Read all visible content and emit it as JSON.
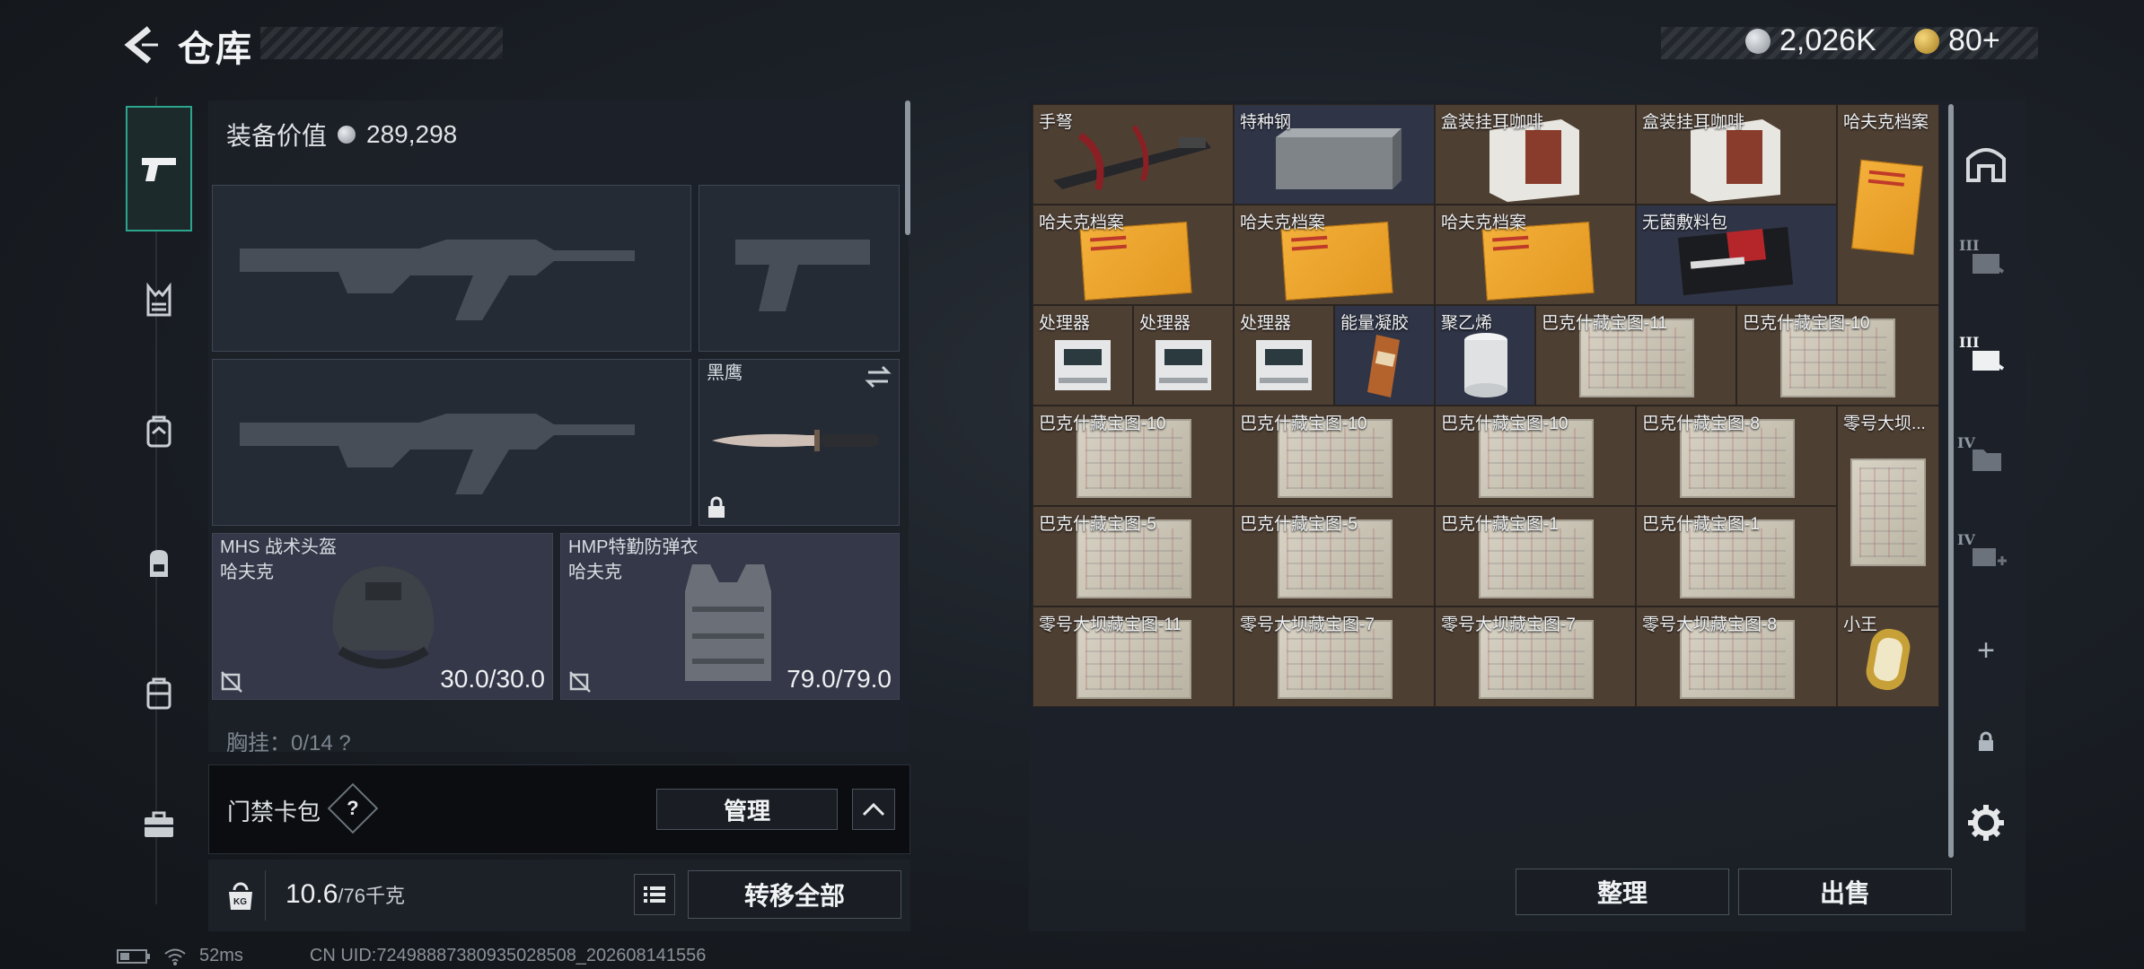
{
  "header": {
    "title": "仓库",
    "currency_primary": "2,026K",
    "currency_secondary": "80+"
  },
  "colors": {
    "accent_green": "#2ca58d",
    "cell_brown": "#4e3f33",
    "cell_blue": "#2f3446"
  },
  "sidenav": {
    "items": [
      {
        "icon": "pistol-icon",
        "active": true
      },
      {
        "icon": "vest-icon"
      },
      {
        "icon": "armor-rig-icon"
      },
      {
        "icon": "backpack-icon"
      },
      {
        "icon": "pouch-icon"
      },
      {
        "icon": "briefcase-icon"
      }
    ]
  },
  "equipment": {
    "value_label": "装备价值",
    "value": "289,298",
    "slots": {
      "melee_name": "黑鹰",
      "helmet_name": "MHS 战术头盔",
      "helmet_brand": "哈夫克",
      "helmet_durability": "30.0/30.0",
      "armor_name": "HMP特勤防弹衣",
      "armor_brand": "哈夫克",
      "armor_durability": "79.0/79.0"
    },
    "chest_hint": "胸挂：0/14 ?"
  },
  "access_card": {
    "label": "门禁卡包",
    "help": "?",
    "manage": "管理"
  },
  "weight": {
    "icon_text": "KG",
    "current": "10.6",
    "max": "/76千克",
    "transfer_all": "转移全部"
  },
  "status": {
    "ping": "52ms",
    "uid": "CN UID:72498887380935028508_202608141556"
  },
  "stash": {
    "items": [
      {
        "name": "手弩"
      },
      {
        "name": "特种钢"
      },
      {
        "name": "盒装挂耳咖啡"
      },
      {
        "name": "盒装挂耳咖啡"
      },
      {
        "name": "哈夫克档案"
      },
      {
        "name": "哈夫克档案"
      },
      {
        "name": "哈夫克档案"
      },
      {
        "name": "哈夫克档案"
      },
      {
        "name": "无菌敷料包"
      },
      {
        "name": "处理器"
      },
      {
        "name": "处理器"
      },
      {
        "name": "处理器"
      },
      {
        "name": "能量凝胶"
      },
      {
        "name": "聚乙烯"
      },
      {
        "name": "巴克什藏宝图-11"
      },
      {
        "name": "巴克什藏宝图-10"
      },
      {
        "name": "巴克什藏宝图-10"
      },
      {
        "name": "巴克什藏宝图-10"
      },
      {
        "name": "巴克什藏宝图-10"
      },
      {
        "name": "巴克什藏宝图-8"
      },
      {
        "name": "零号大坝..."
      },
      {
        "name": "巴克什藏宝图-5"
      },
      {
        "name": "巴克什藏宝图-5"
      },
      {
        "name": "巴克什藏宝图-1"
      },
      {
        "name": "巴克什藏宝图-1"
      },
      {
        "name": "零号大坝藏宝图-11"
      },
      {
        "name": "零号大坝藏宝图-7"
      },
      {
        "name": "零号大坝藏宝图-7"
      },
      {
        "name": "零号大坝藏宝图-8"
      },
      {
        "name": "小王"
      }
    ],
    "sort": "整理",
    "sell": "出售"
  },
  "right_tabs": [
    {
      "icon": "stash-main-icon"
    },
    {
      "icon": "stash-iii-icon",
      "label": "III"
    },
    {
      "icon": "stash-iii-selected-icon",
      "label": "III"
    },
    {
      "icon": "stash-iv-icon",
      "label": "IV"
    },
    {
      "icon": "stash-iv-add-icon",
      "label": "IV"
    },
    {
      "icon": "plus-icon",
      "label": "+"
    },
    {
      "icon": "lock-icon"
    },
    {
      "icon": "gear-icon"
    }
  ]
}
